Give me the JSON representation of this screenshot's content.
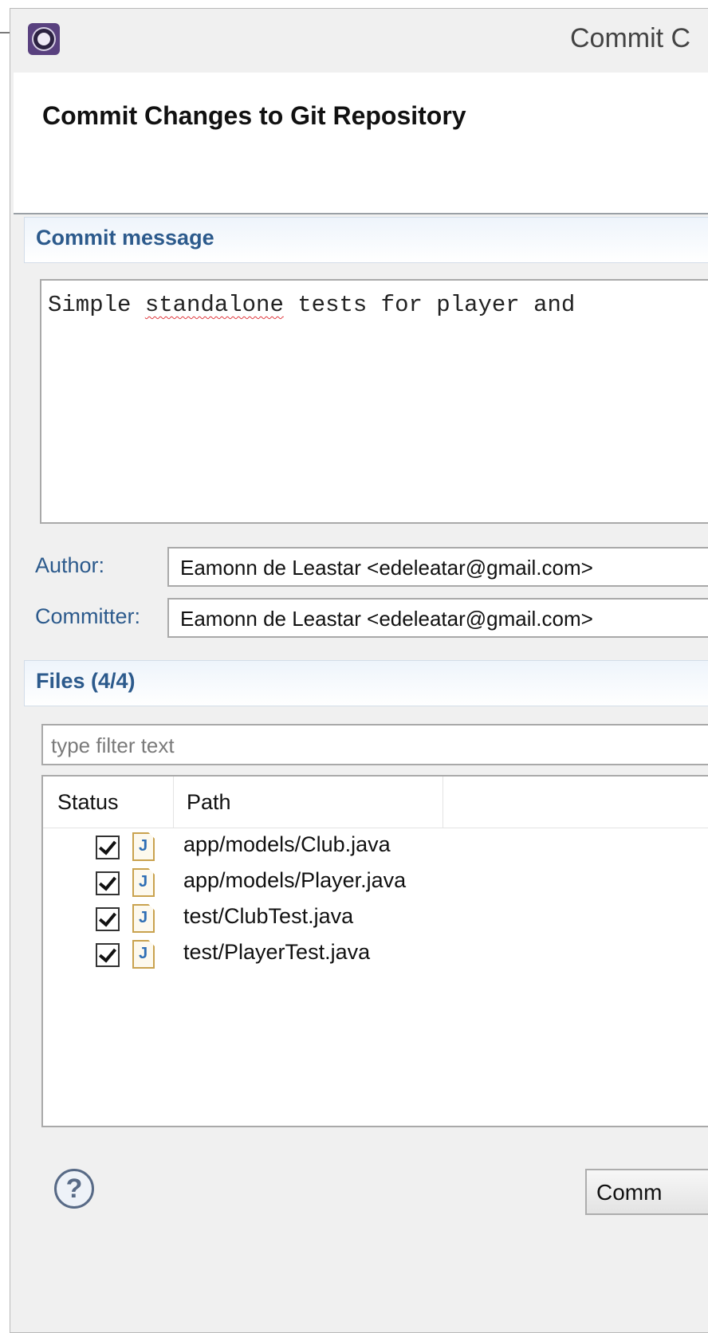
{
  "window": {
    "title": "Commit C"
  },
  "banner": {
    "title": "Commit Changes to Git Repository"
  },
  "commit_message": {
    "header": "Commit message",
    "text_part1": "Simple ",
    "text_misspelled": "standalone",
    "text_part2": " tests for player and"
  },
  "author": {
    "label": "Author:",
    "value": "Eamonn de Leastar <edeleatar@gmail.com>"
  },
  "committer": {
    "label": "Committer:",
    "value": "Eamonn de Leastar <edeleatar@gmail.com>"
  },
  "files": {
    "header": "Files (4/4)",
    "filter_placeholder": "type filter text",
    "columns": {
      "status": "Status",
      "path": "Path"
    },
    "rows": [
      {
        "path": "app/models/Club.java",
        "icon": "J",
        "checked": true
      },
      {
        "path": "app/models/Player.java",
        "icon": "J",
        "checked": true
      },
      {
        "path": "test/ClubTest.java",
        "icon": "J",
        "checked": true
      },
      {
        "path": "test/PlayerTest.java",
        "icon": "J",
        "checked": true
      }
    ]
  },
  "footer": {
    "help_glyph": "?",
    "commit_button": "Comm"
  },
  "colors": {
    "section_header_text": "#2c5a8c",
    "app_icon": "#59417f"
  }
}
